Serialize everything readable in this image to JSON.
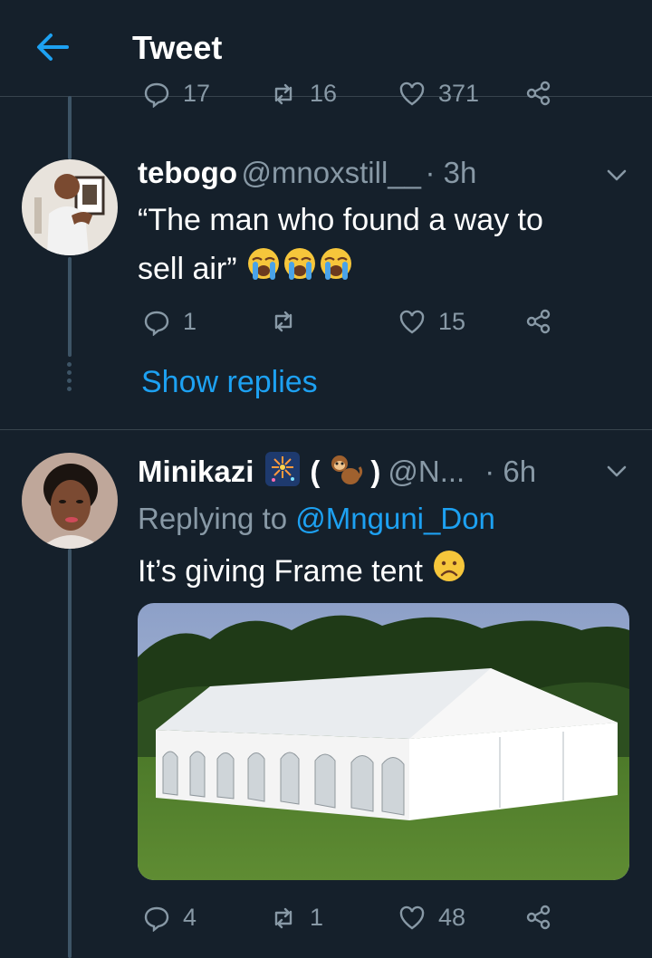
{
  "header": {
    "title": "Tweet"
  },
  "prev_actions": {
    "replies": "17",
    "retweets": "16",
    "likes": "371"
  },
  "tweet1": {
    "name": "tebogo",
    "handle": "@mnoxstill__",
    "time": "· 3h",
    "text_line1": "“The man who found a way to",
    "text_line2": "sell air”",
    "replies": "1",
    "retweets": "",
    "likes": "15",
    "show_replies": "Show replies"
  },
  "tweet2": {
    "name": "Minikazi",
    "paren_open": "(",
    "paren_close": ")",
    "handle": "@N...",
    "time": "· 6h",
    "replying_prefix": "Replying to",
    "replying_to": "@Mnguni_Don",
    "text": "It’s giving Frame tent",
    "replies": "4",
    "retweets": "1",
    "likes": "48"
  },
  "colors": {
    "accent": "#1da1f2",
    "background": "#15202b",
    "muted": "#8899a6"
  }
}
